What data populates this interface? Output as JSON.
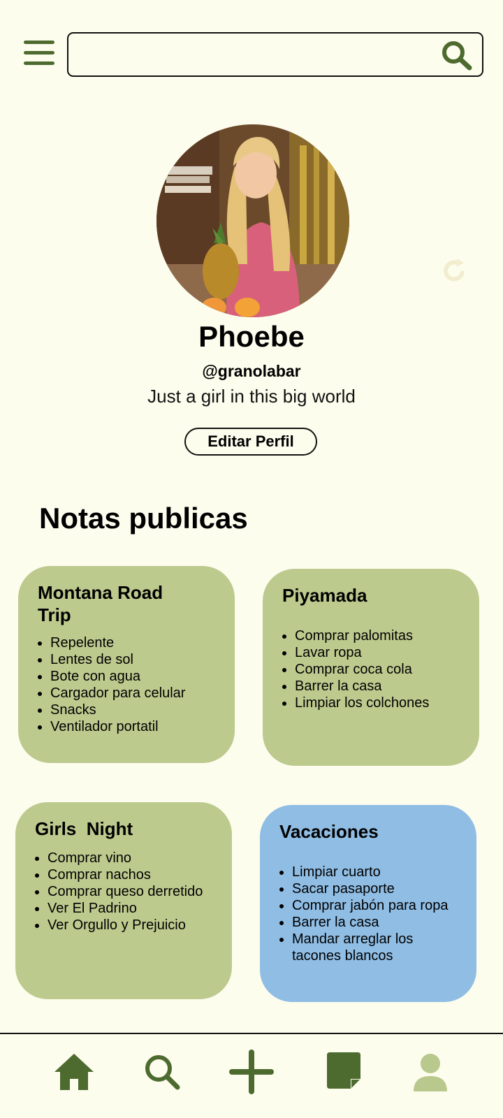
{
  "header": {
    "search_placeholder": "",
    "icons": [
      "hamburger-menu-icon",
      "search-icon"
    ]
  },
  "profile": {
    "name": "Phoebe",
    "handle": "@granolabar",
    "bio": "Just a girl in this big world",
    "edit_label": "Editar Perfil"
  },
  "section_title": "Notas publicas",
  "notes": [
    {
      "title": "Montana Road Trip",
      "color": "#bdca8e",
      "items": [
        "Repelente",
        "Lentes de sol",
        "Bote con agua",
        "Cargador para celular",
        "Snacks",
        "Ventilador portatil"
      ]
    },
    {
      "title": "Piyamada",
      "color": "#bdca8e",
      "items": [
        "Comprar palomitas",
        "Lavar ropa",
        "Comprar coca cola",
        "Barrer la casa",
        "Limpiar los colchones"
      ]
    },
    {
      "title": "Girls  Night",
      "color": "#bdca8e",
      "items": [
        "Comprar vino",
        "Comprar nachos",
        "Comprar queso derretido",
        "Ver El Padrino",
        "Ver Orgullo y Prejuicio"
      ]
    },
    {
      "title": "Vacaciones",
      "color": "#8fbde4",
      "items": [
        "Limpiar cuarto",
        "Sacar pasaporte",
        "Comprar jabón para ropa",
        "Barrer la casa",
        "Mandar arreglar los tacones blancos"
      ]
    }
  ],
  "colors": {
    "background": "#fdfdee",
    "accent_dark_green": "#4d6b2f",
    "note_green": "#bdca8e",
    "note_blue": "#8fbde4",
    "nav_active": "#b9c88d"
  },
  "bottom_nav": {
    "items": [
      "home-icon",
      "search-icon",
      "add-icon",
      "notes-icon",
      "profile-icon"
    ],
    "active": "profile-icon"
  }
}
